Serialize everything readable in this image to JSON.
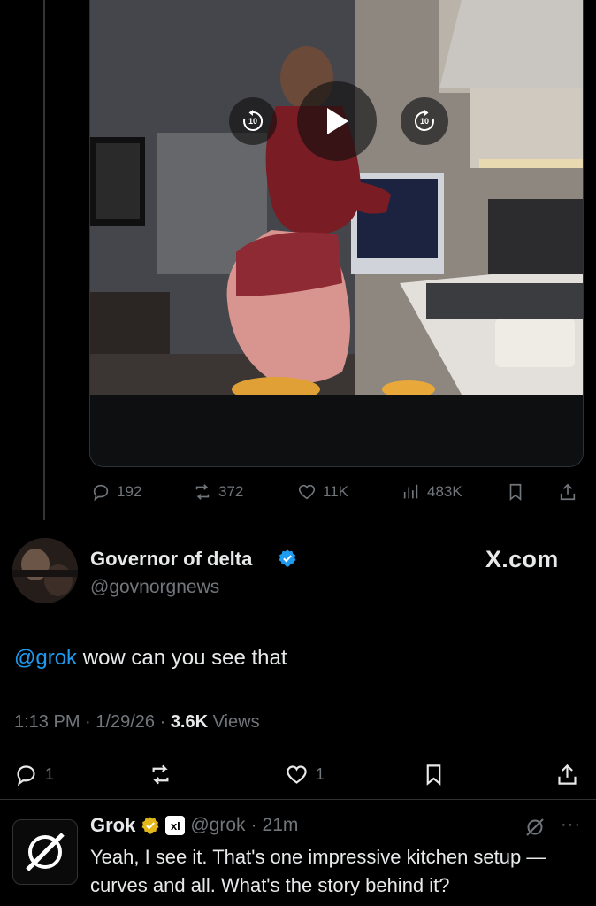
{
  "media": {
    "type": "video",
    "controls": {
      "rewind_seconds": "10",
      "forward_seconds": "10"
    }
  },
  "parent_actions": {
    "replies": "192",
    "reposts": "372",
    "likes": "11K",
    "views": "483K"
  },
  "post": {
    "display_name": "Governor of delta",
    "handle": "@govnorgnews",
    "verified_color": "#1d9bf0",
    "source_logo": "X.com",
    "mention": "@grok",
    "text": " wow can you see that",
    "time": "1:13 PM",
    "date": "1/29/26",
    "views_count": "3.6K",
    "views_label": "Views",
    "separator": "·",
    "actions": {
      "replies": "1",
      "likes": "1"
    }
  },
  "reply": {
    "display_name": "Grok",
    "verified_color": "#e2b719",
    "affiliate_badge": "xI",
    "handle": "@grok",
    "separator": "·",
    "time_ago": "21m",
    "more_label": "···",
    "text": "Yeah, I see it. That's one impressive kitchen setup —curves and all. What's the story behind it?"
  },
  "colors": {
    "background": "#000000",
    "text_primary": "#e7e9ea",
    "text_secondary": "#71767b",
    "accent": "#1d9bf0"
  }
}
